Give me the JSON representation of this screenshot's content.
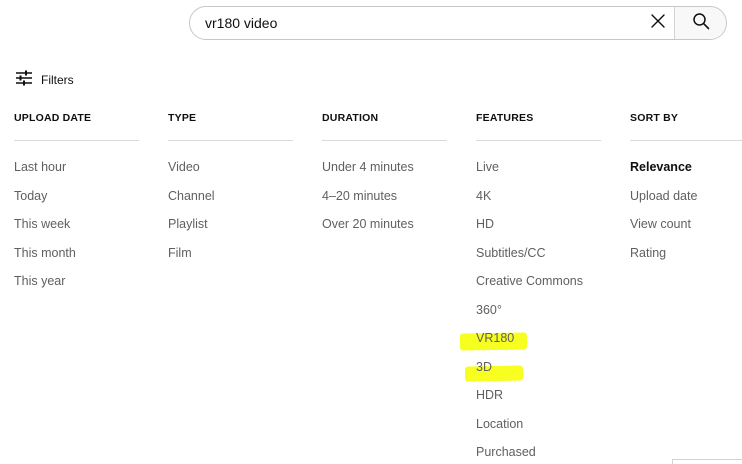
{
  "search": {
    "query": "vr180 video"
  },
  "filters_button": {
    "label": "Filters"
  },
  "columns": [
    {
      "header": "UPLOAD DATE",
      "options": [
        "Last hour",
        "Today",
        "This week",
        "This month",
        "This year"
      ]
    },
    {
      "header": "TYPE",
      "options": [
        "Video",
        "Channel",
        "Playlist",
        "Film"
      ]
    },
    {
      "header": "DURATION",
      "options": [
        "Under 4 minutes",
        "4–20 minutes",
        "Over 20 minutes"
      ]
    },
    {
      "header": "FEATURES",
      "options": [
        "Live",
        "4K",
        "HD",
        "Subtitles/CC",
        "Creative Commons",
        "360°",
        "VR180",
        "3D",
        "HDR",
        "Location",
        "Purchased"
      ]
    },
    {
      "header": "SORT BY",
      "options": [
        "Relevance",
        "Upload date",
        "View count",
        "Rating"
      ],
      "selected": "Relevance"
    }
  ],
  "highlight_color": "#f6ff1f",
  "icons": {
    "clear": "close-icon",
    "search": "search-icon",
    "filters": "tune-icon"
  }
}
